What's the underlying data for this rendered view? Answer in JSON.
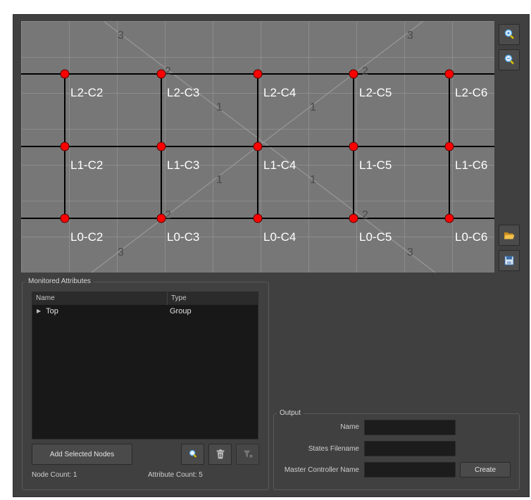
{
  "canvas": {
    "grid_labels": [
      "L2-C2",
      "L2-C3",
      "L2-C4",
      "L2-C5",
      "L2-C6",
      "L1-C2",
      "L1-C3",
      "L1-C4",
      "L1-C5",
      "L1-C6",
      "L0-C2",
      "L0-C3",
      "L0-C4",
      "L0-C5",
      "L0-C6"
    ],
    "diagonal_labels": [
      "3",
      "3",
      "2",
      "2",
      "1",
      "1",
      "1",
      "1",
      "2",
      "2",
      "3",
      "3"
    ],
    "colors": {
      "background": "#777777",
      "grid_line": "#8c8c8c",
      "node_line": "#000000",
      "node_fill": "#ff0000",
      "label_text": "#ffffff",
      "diagonal_line": "#999999",
      "diagonal_text": "#4a4a4a"
    }
  },
  "side_buttons": {
    "zoom_in_icon": "zoom-in-icon",
    "zoom_out_icon": "zoom-out-icon",
    "open_icon": "folder-open-icon",
    "save_icon": "save-icon"
  },
  "monitored": {
    "title": "Monitored Attributes",
    "columns": {
      "name": "Name",
      "type": "Type"
    },
    "rows": [
      {
        "name": "Top",
        "type": "Group"
      }
    ],
    "add_button": "Add Selected Nodes",
    "node_count": "Node Count: 1",
    "attribute_count": "Attribute Count: 5"
  },
  "output": {
    "title": "Output",
    "name_label": "Name",
    "states_label": "States Filename",
    "master_label": "Master Controller Name",
    "name_value": "",
    "states_value": "",
    "master_value": "",
    "create_button": "Create"
  }
}
